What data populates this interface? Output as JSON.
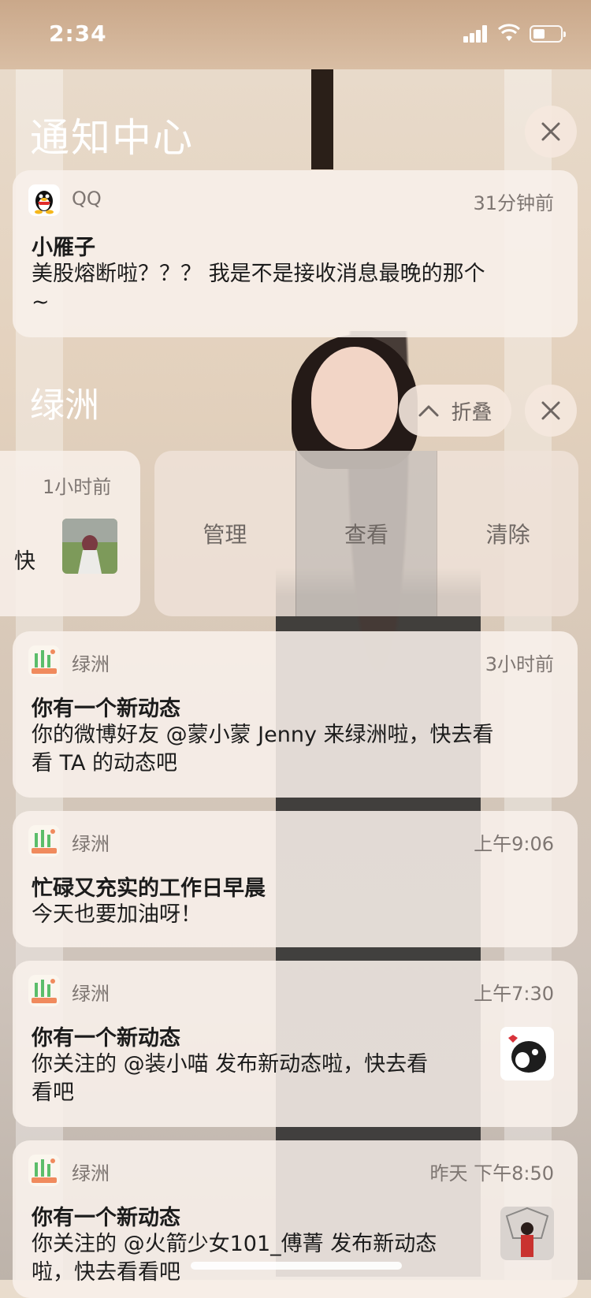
{
  "status_bar": {
    "time": "2:34"
  },
  "header": {
    "title": "通知中心"
  },
  "qq_notification": {
    "app_name": "QQ",
    "time": "31分钟前",
    "title": "小雁子",
    "body_line1": "美股熔断啦？？？ 我是不是接收消息最晚的那个",
    "body_line2": "~"
  },
  "group": {
    "title": "绿洲",
    "fold_label": "折叠",
    "swiped_item": {
      "time": "1小时前",
      "snippet": "快"
    },
    "actions": [
      "管理",
      "查看",
      "清除"
    ]
  },
  "notifications": [
    {
      "app_name": "绿洲",
      "time": "3小时前",
      "title": "你有一个新动态",
      "body_line1": "你的微博好友 @蒙小蒙 Jenny 来绿洲啦，快去看",
      "body_line2": "看 TA 的动态吧"
    },
    {
      "app_name": "绿洲",
      "time": "上午9:06",
      "title": "忙碌又充实的工作日早晨",
      "body_line1": "今天也要加油呀！"
    },
    {
      "app_name": "绿洲",
      "time": "上午7:30",
      "title": "你有一个新动态",
      "body_line1": "你关注的 @装小喵 发布新动态啦，快去看",
      "body_line2": "看吧"
    },
    {
      "app_name": "绿洲",
      "time": "昨天 下午8:50",
      "title": "你有一个新动态",
      "body_line1": "你关注的 @火箭少女101_傅菁 发布新动态",
      "body_line2": "啦，快去看看吧"
    }
  ],
  "colors": {
    "card_bg": "#f8f0ea",
    "secondary_text": "#7e7672",
    "primary_text": "#1c1c1c",
    "oasis_green": "#5bbd6a",
    "qq_black": "#111111"
  }
}
